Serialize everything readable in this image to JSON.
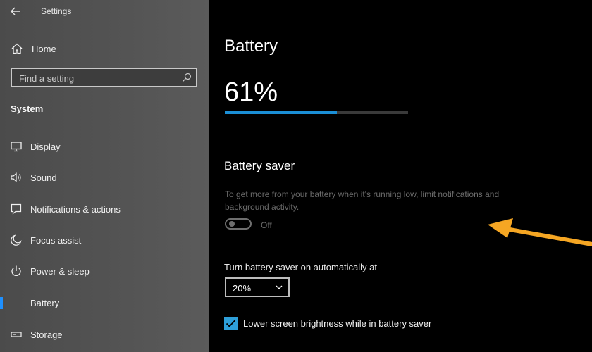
{
  "window": {
    "title": "Settings"
  },
  "sidebar": {
    "home_label": "Home",
    "search_placeholder": "Find a setting",
    "section_title": "System",
    "items": [
      {
        "label": "Display",
        "icon": "monitor-icon"
      },
      {
        "label": "Sound",
        "icon": "speaker-icon"
      },
      {
        "label": "Notifications & actions",
        "icon": "notification-icon"
      },
      {
        "label": "Focus assist",
        "icon": "moon-icon"
      },
      {
        "label": "Power & sleep",
        "icon": "power-icon"
      },
      {
        "label": "Battery",
        "icon": "battery-icon",
        "active": true
      },
      {
        "label": "Storage",
        "icon": "storage-icon"
      }
    ]
  },
  "main": {
    "title": "Battery",
    "percent_text": "61%",
    "percent_value": 61,
    "saver": {
      "heading": "Battery saver",
      "description": "To get more from your battery when it's running low, limit notifications and background activity.",
      "toggle_state": "Off",
      "auto_label": "Turn battery saver on automatically at",
      "auto_value": "20%",
      "brightness_label": "Lower screen brightness while in battery saver",
      "brightness_checked": true
    }
  },
  "colors": {
    "accent": "#1b8fd6",
    "arrow": "#f5a623",
    "checkbox": "#2e9fd9"
  }
}
